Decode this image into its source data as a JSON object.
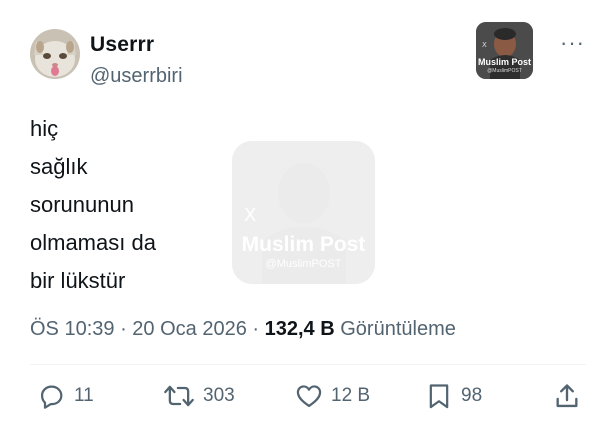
{
  "author": {
    "name": "Userrr",
    "handle": "@userrbiri"
  },
  "watermark": {
    "title": "Muslim Post",
    "subtitle": "@MuslimPOST"
  },
  "more_label": "···",
  "tweet": {
    "lines": [
      "hiç",
      "sağlık",
      "sorununun",
      "olmaması da",
      "bir lükstür"
    ]
  },
  "meta": {
    "time": "ÖS 10:39",
    "separator1": " · ",
    "date": "20 Oca 2026",
    "separator2": " · ",
    "views_count": "132,4 B",
    "views_label": "Görüntüleme"
  },
  "actions": {
    "replies": "11",
    "retweets": "303",
    "likes": "12 B",
    "bookmarks": "98"
  },
  "icons": {
    "reply": "reply-icon",
    "retweet": "retweet-icon",
    "like": "heart-icon",
    "bookmark": "bookmark-icon",
    "share": "share-icon"
  },
  "colors": {
    "text": "#0f1419",
    "secondary": "#536471",
    "divider": "#eff3f4"
  }
}
